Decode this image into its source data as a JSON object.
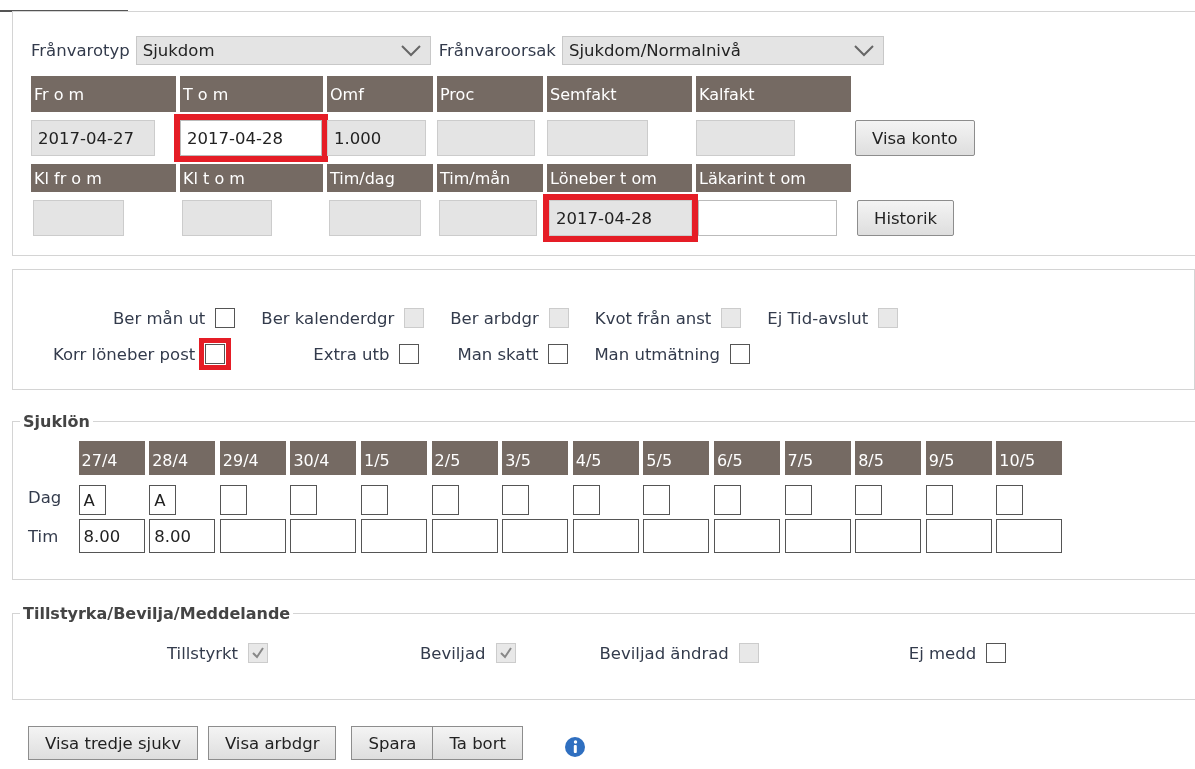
{
  "absence": [
    {
      "label": "Frånvarotyp",
      "value": "Sjukdom"
    },
    {
      "label": "Frånvaroorsak",
      "value": "Sjukdom/Normalnivå"
    }
  ],
  "field_rows": [
    {
      "columns": [
        {
          "label": "Fr o m",
          "value": "2017-04-27",
          "disabled": true,
          "highlighted": false
        },
        {
          "label": "T o m",
          "value": "2017-04-28",
          "disabled": false,
          "highlighted": true
        },
        {
          "label": "Omf",
          "value": "1.000",
          "disabled": true,
          "highlighted": false
        },
        {
          "label": "Proc",
          "disabled": true,
          "highlighted": false
        },
        {
          "label": "Semfakt",
          "disabled": true,
          "highlighted": false
        },
        {
          "label": "Kalfakt",
          "disabled": true,
          "highlighted": false
        }
      ],
      "button": "Visa konto"
    },
    {
      "columns": [
        {
          "label": "Kl fr o m",
          "disabled": true,
          "highlighted": false
        },
        {
          "label": "Kl t o m",
          "disabled": true,
          "highlighted": false
        },
        {
          "label": "Tim/dag",
          "disabled": true,
          "highlighted": false
        },
        {
          "label": "Tim/mån",
          "disabled": true,
          "highlighted": false
        },
        {
          "label": "Löneber t om",
          "value": "2017-04-28",
          "disabled": true,
          "highlighted": true
        },
        {
          "label": "Läkarint t om",
          "disabled": false,
          "highlighted": false
        }
      ],
      "button": "Historik"
    }
  ],
  "options": [
    [
      {
        "label": "Ber mån ut",
        "checked": false,
        "disabled": false,
        "highlighted": false
      },
      {
        "label": "Ber kalenderdgr",
        "checked": false,
        "disabled": true,
        "highlighted": false
      },
      {
        "label": "Ber arbdgr",
        "checked": false,
        "disabled": true,
        "highlighted": false
      },
      {
        "label": "Kvot från anst",
        "checked": false,
        "disabled": true,
        "highlighted": false
      },
      {
        "label": "Ej Tid-avslut",
        "checked": false,
        "disabled": true,
        "highlighted": false
      }
    ],
    [
      {
        "label": "Korr löneber post",
        "checked": false,
        "disabled": false,
        "highlighted": true
      },
      {
        "label": "Extra utb",
        "checked": false,
        "disabled": false,
        "highlighted": false
      },
      {
        "label": "Man skatt",
        "checked": false,
        "disabled": false,
        "highlighted": false
      },
      {
        "label": "Man utmätning",
        "checked": false,
        "disabled": false,
        "highlighted": false
      }
    ]
  ],
  "sick_pay": {
    "title": "Sjuklön",
    "row_labels": [
      "Dag",
      "Tim"
    ],
    "days": [
      {
        "date": "27/4",
        "dag": "A",
        "tim": "8.00"
      },
      {
        "date": "28/4",
        "dag": "A",
        "tim": "8.00"
      },
      {
        "date": "29/4"
      },
      {
        "date": "30/4"
      },
      {
        "date": "1/5"
      },
      {
        "date": "2/5"
      },
      {
        "date": "3/5"
      },
      {
        "date": "4/5"
      },
      {
        "date": "5/5"
      },
      {
        "date": "6/5"
      },
      {
        "date": "7/5"
      },
      {
        "date": "8/5"
      },
      {
        "date": "9/5"
      },
      {
        "date": "10/5"
      }
    ]
  },
  "approval": {
    "title": "Tillstyrka/Bevilja/Meddelande",
    "items": [
      {
        "label": "Tillstyrkt",
        "checked": true,
        "disabled": true
      },
      {
        "label": "Beviljad",
        "checked": true,
        "disabled": true
      },
      {
        "label": "Beviljad ändrad",
        "checked": false,
        "disabled": true
      },
      {
        "label": "Ej medd",
        "checked": false,
        "disabled": false
      }
    ]
  },
  "button_groups": [
    [
      "Visa tredje sjukv"
    ],
    [
      "Visa arbdgr"
    ],
    [
      "Spara",
      "Ta bort"
    ]
  ]
}
